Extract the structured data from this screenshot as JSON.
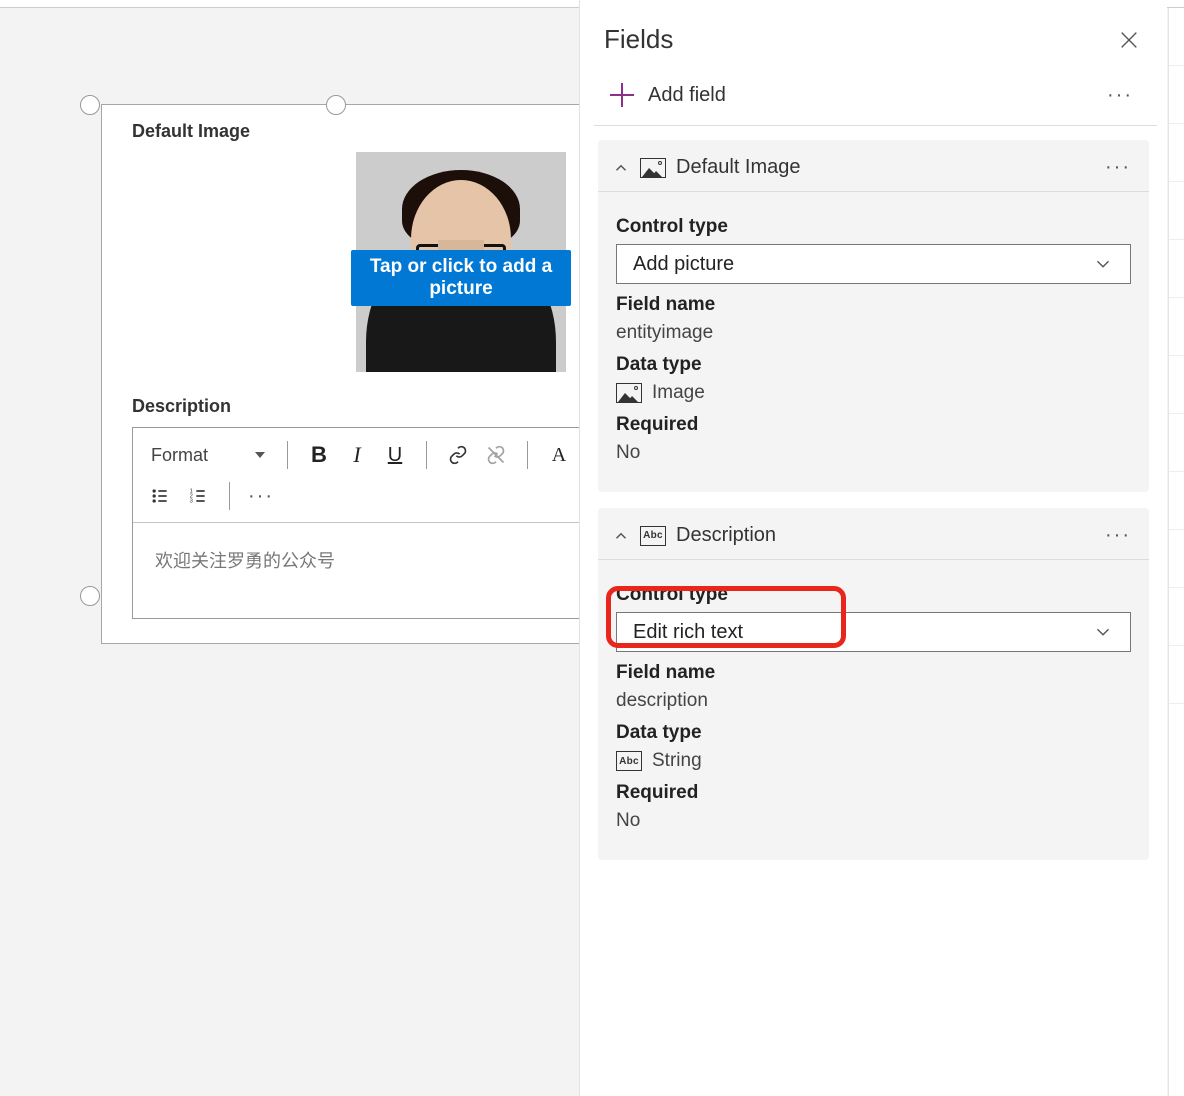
{
  "panel": {
    "title": "Fields",
    "add_field": "Add field"
  },
  "form": {
    "image_field_label": "Default Image",
    "image_overlay": "Tap or click to add a picture",
    "description_label": "Description",
    "rte": {
      "format": "Format",
      "placeholder": "欢迎关注罗勇的公众号"
    }
  },
  "sections": [
    {
      "title": "Default Image",
      "icon": "image",
      "control_type_label": "Control type",
      "control_type_value": "Add picture",
      "field_name_label": "Field name",
      "field_name_value": "entityimage",
      "data_type_label": "Data type",
      "data_type_value": "Image",
      "required_label": "Required",
      "required_value": "No"
    },
    {
      "title": "Description",
      "icon": "abc",
      "control_type_label": "Control type",
      "control_type_value": "Edit rich text",
      "field_name_label": "Field name",
      "field_name_value": "description",
      "data_type_label": "Data type",
      "data_type_value": "String",
      "required_label": "Required",
      "required_value": "No"
    }
  ]
}
